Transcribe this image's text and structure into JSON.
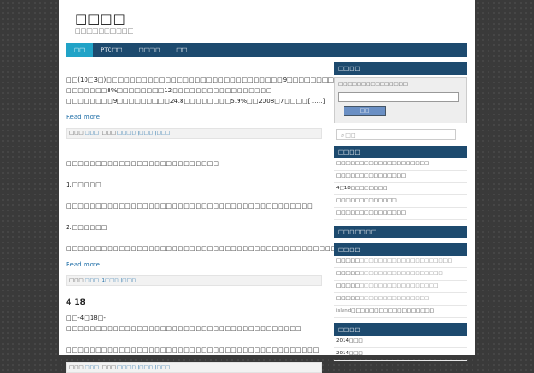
{
  "site": {
    "title": "□□□□",
    "description": "□□□□□□□□□□"
  },
  "nav": [
    "□□",
    "PTC□□",
    "□□□□",
    "□□"
  ],
  "posts": [
    {
      "lines": [
        "□□(10□3□)□□□□□□□□□□□□□□□□□□□□□□□□□□□□□□9□□□□□□□□□□□□□□□□□□□□□□□□□□",
        "□□□□□□□8%□□□□□□□□12□□□□□□□□□□□□□□□□□",
        "□□□□□□□□9□□□□□□□□□24.8□□□□□□□□5.9%□□2008□7□□□□[……]"
      ],
      "readmore": "Read more",
      "meta": [
        "□□□",
        "□□□",
        "|□□□",
        "□□□□",
        "|□□□",
        "|□□□"
      ]
    },
    {
      "lines": [
        "□□□□□□□□□□□□□□□□□□□□□□□□□□",
        "1.□□□□□",
        "□□□□□□□□□□□□□□□□□□□□□□□□□□□□□□□□□□□□□□□□□□",
        "2.□□□□□□",
        "□□□□□□□□□□□□□□□□□□□□□□□□□□□□□□□□□□□□□□□□□□□□□□□□□□[……]"
      ],
      "readmore": "Read more",
      "meta": [
        "□□□",
        "□□□",
        "|1□□□",
        "|□□□"
      ]
    },
    {
      "title": "4  18",
      "lines": [
        "□□-4□18□-□□□□□□□□□□□□□□□□□□□□□□□□□□□□□□□□□□□□□□□□",
        "□□□□□□□□□□□□□□□□□□□□□□□□□□□□□□□□□□□□□□□□□□□"
      ],
      "meta": [
        "□□□",
        "□□□",
        "|□□□",
        "□□□□",
        "|□□□",
        "|□□□"
      ]
    }
  ],
  "sidebar": {
    "login_title": "□□□□",
    "login_text": "□□□□□□□□□□□□□□□",
    "login_button": "□□",
    "search_placeholder": "□□",
    "recent_title": "□□□□",
    "recent": [
      "□□□□□□□□□□□□□□□□□□□□",
      "□□□□□□□□□□□□□□□",
      "4□18□□□□□□□□",
      "□□□□□□□□□□□□□",
      "□□□□□□□□□□□□□□□"
    ],
    "cats_title": "□□□□□□□",
    "comments_title": "□□□□",
    "comments": [
      {
        "who": "□□□□□",
        "txt": "□□□□□□□□□□□□□□□□□□□□"
      },
      {
        "who": "□□□□□",
        "txt": "□□□□□□□□□□□□□□□□□□"
      },
      {
        "who": "□□□□□",
        "txt": "□□□□□□□□□□□□□□□□□"
      },
      {
        "who": "□□□□□",
        "txt": "□□□□□□□□□□□□□□□"
      },
      {
        "who": "island",
        "txt": "□□□□□□□□□□□□□□□□□□"
      }
    ],
    "archive_title": "□□□□",
    "archive": [
      "2014□□□",
      "2014□□□"
    ]
  }
}
